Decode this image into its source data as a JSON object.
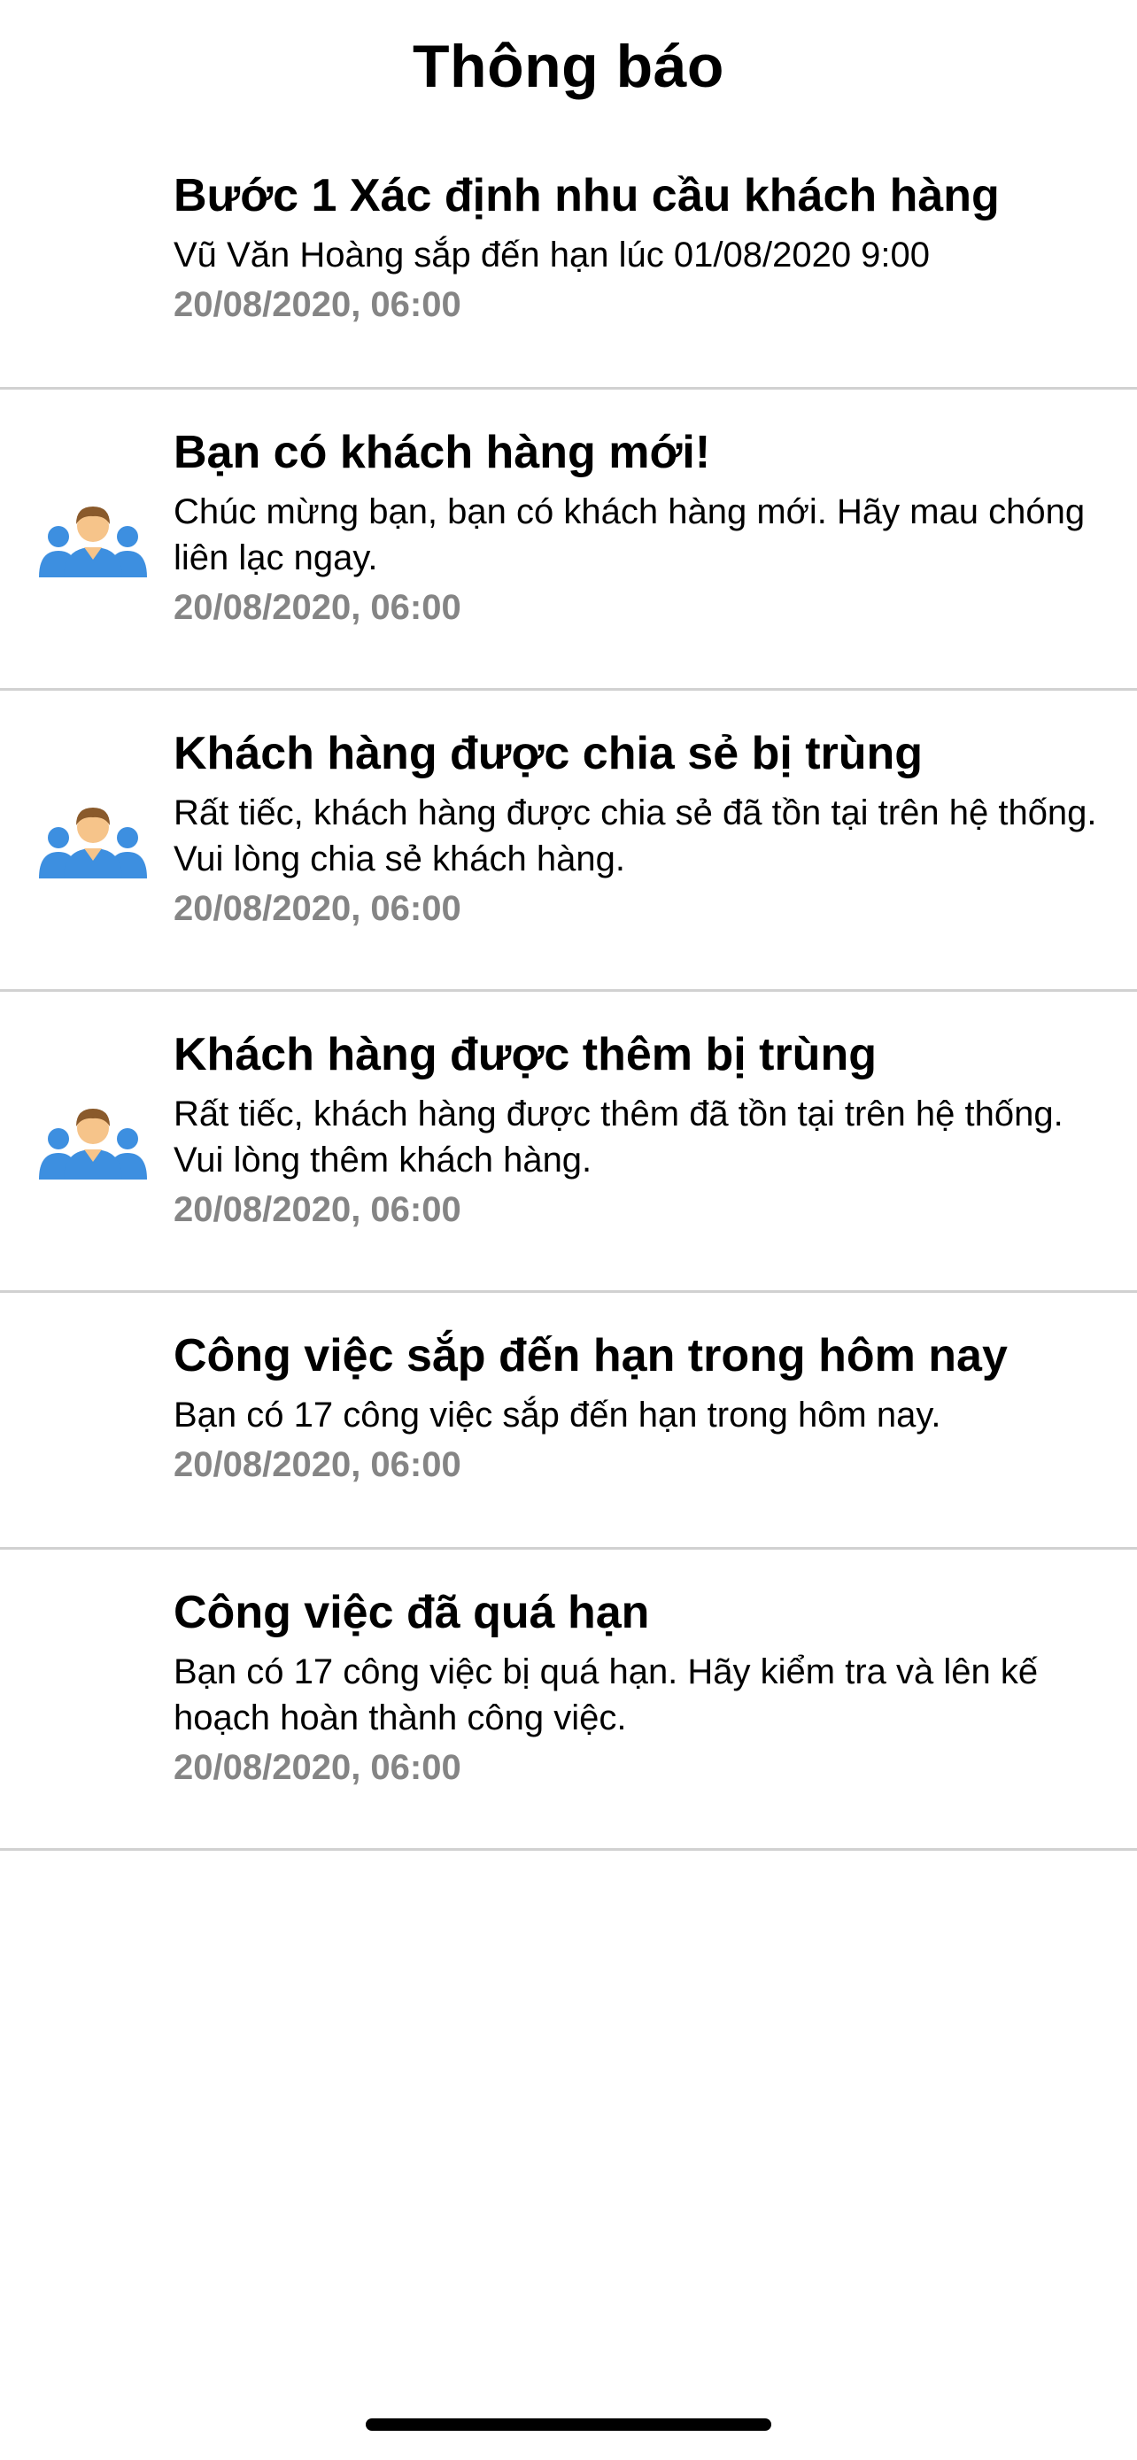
{
  "header": {
    "title": "Thông báo"
  },
  "notifications": [
    {
      "title": "Bước 1 Xác định nhu cầu khách hàng",
      "message": "Vũ Văn Hoàng sắp đến hạn lúc 01/08/2020 9:00",
      "time": "20/08/2020, 06:00",
      "icon": null
    },
    {
      "title": "Bạn có khách hàng mới!",
      "message": "Chúc mừng bạn, bạn có khách hàng mới. Hãy mau chóng liên lạc ngay.",
      "time": "20/08/2020, 06:00",
      "icon": "customers-group-icon"
    },
    {
      "title": "Khách hàng được chia sẻ bị trùng",
      "message": "Rất tiếc, khách hàng được chia sẻ đã tồn tại trên hệ thống. Vui lòng chia sẻ khách hàng.",
      "time": "20/08/2020, 06:00",
      "icon": "customers-group-icon"
    },
    {
      "title": "Khách hàng được thêm bị trùng",
      "message": "Rất tiếc, khách hàng được thêm đã tồn tại trên hệ thống. Vui lòng thêm khách hàng.",
      "time": "20/08/2020, 06:00",
      "icon": "customers-group-icon"
    },
    {
      "title": "Công việc sắp đến hạn trong hôm nay",
      "message": "Bạn có 17 công việc sắp đến hạn trong hôm nay.",
      "time": "20/08/2020, 06:00",
      "icon": null
    },
    {
      "title": "Công việc đã quá hạn",
      "message": "Bạn có 17 công việc bị quá hạn. Hãy kiểm tra và lên kế hoạch hoàn thành công việc.",
      "time": "20/08/2020, 06:00",
      "icon": null
    }
  ],
  "colors": {
    "text": "#000000",
    "timestamp": "#858585",
    "divider": "#d1d1d1",
    "icon_person_blue": "#3d8fe0",
    "icon_person_skin": "#f6c48a",
    "icon_person_hair": "#8a5a2b"
  }
}
